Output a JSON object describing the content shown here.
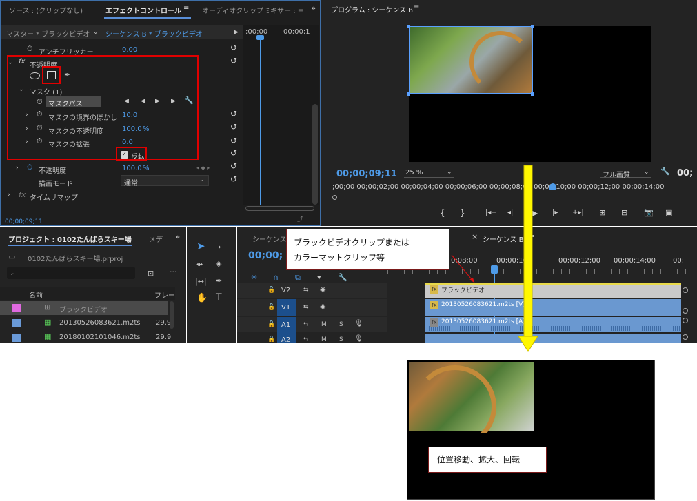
{
  "effect_panel": {
    "tabs": [
      "ソース : (クリップなし)",
      "エフェクトコントロール",
      "オーディオクリップミキサー : ≡"
    ],
    "menu_icon": "≡",
    "master_label": "マスター * ブラックビデオ",
    "sequence_label": "シーケンス B * ブラックビデオ",
    "ruler_times": [
      ";00;00",
      "00;00;1"
    ],
    "rows": {
      "anti_flicker": {
        "label": "アンチフリッカー",
        "value": "0.00"
      },
      "opacity_group": {
        "label": "不透明度"
      },
      "mask_group": {
        "label": "マスク (1)"
      },
      "mask_path": {
        "label": "マスクパス"
      },
      "mask_feather": {
        "label": "マスクの境界のぼかし",
        "value": "10.0"
      },
      "mask_opacity": {
        "label": "マスクの不透明度",
        "value": "100.0",
        "unit": "%"
      },
      "mask_expansion": {
        "label": "マスクの拡張",
        "value": "0.0"
      },
      "inverted": {
        "label": "反転",
        "checked": true
      },
      "opacity": {
        "label": "不透明度",
        "value": "100.0",
        "unit": "%"
      },
      "blend_mode": {
        "label": "描画モード",
        "value": "通常"
      },
      "time_remap": {
        "label": "タイムリマップ"
      }
    },
    "footer_time": "00;00;09;11"
  },
  "program": {
    "title": "プログラム : シーケンス B",
    "menu_icon": "≡",
    "timecode": "00;00;09;11",
    "zoom": "25 %",
    "quality": "フル画質",
    "right_time": "00;",
    "ruler": ";00;00 00;00;02;00 00;00;04;00 00;00;06;00 00;00;08;00 00;00;10;00 00;00;12;00 00;00;14;00"
  },
  "project": {
    "title": "プロジェクト : 0102たんばらスキー場",
    "other_tab": "メデ",
    "file": "0102たんばらスキー場.prproj",
    "col_name": "名前",
    "col_frame": "フレー",
    "items": [
      {
        "name": "ブラックビデオ",
        "frame": "",
        "color": "#e06ae0"
      },
      {
        "name": "20130526083621.m2ts",
        "frame": "29.9",
        "color": "#6a9ad8"
      },
      {
        "name": "20180102101046.m2ts",
        "frame": "29.9",
        "color": "#6a9ad8"
      }
    ]
  },
  "timeline": {
    "tab_inactive": "シーケンス",
    "tab_active": "シーケンス B",
    "timecode": "00;00;",
    "ruler": [
      "0;08;00",
      "00;00;10",
      "00;00;12;00",
      "00;00;14;00",
      "00;"
    ],
    "tracks": {
      "v2": "V2",
      "v1": "V1",
      "a1": "A1",
      "a2": "A2",
      "a1_src": "A1",
      "a2_src": "A2",
      "mute": "M",
      "solo": "S"
    },
    "clips": {
      "black_video": "ブラックビデオ",
      "video": "20130526083621.m2ts [V]",
      "audio": "20130526083621.m2ts [A]"
    }
  },
  "callouts": {
    "clip_note_line1": "ブラックビデオクリップまたは",
    "clip_note_line2": "カラーマットクリップ等",
    "result_note": "位置移動、拡大、回転"
  }
}
